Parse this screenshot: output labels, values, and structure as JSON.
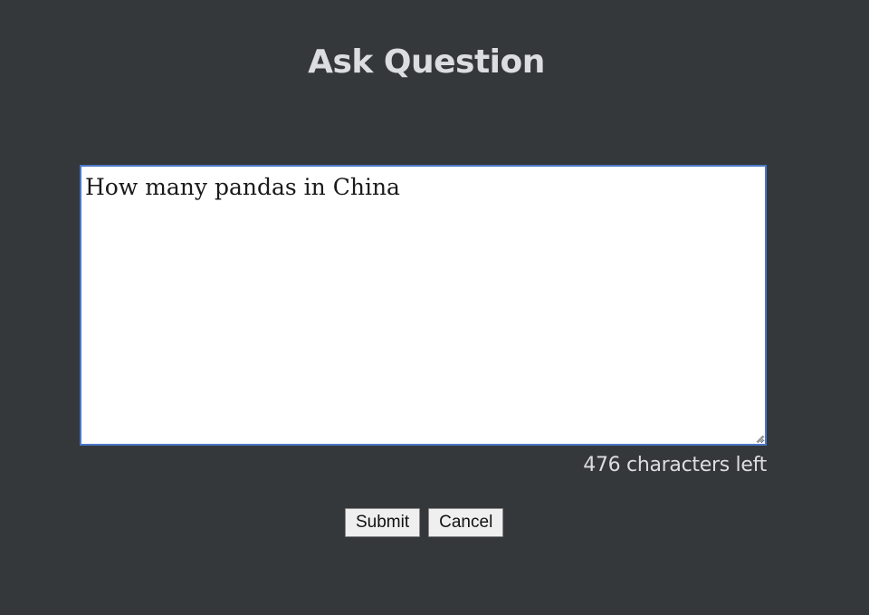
{
  "form": {
    "title": "Ask Question",
    "question_value": "How many pandas in China",
    "char_count_text": "476 characters left",
    "submit_label": "Submit",
    "cancel_label": "Cancel"
  },
  "colors": {
    "background": "#35383b",
    "text": "#dcdde0",
    "input_border": "#4a78c9"
  }
}
